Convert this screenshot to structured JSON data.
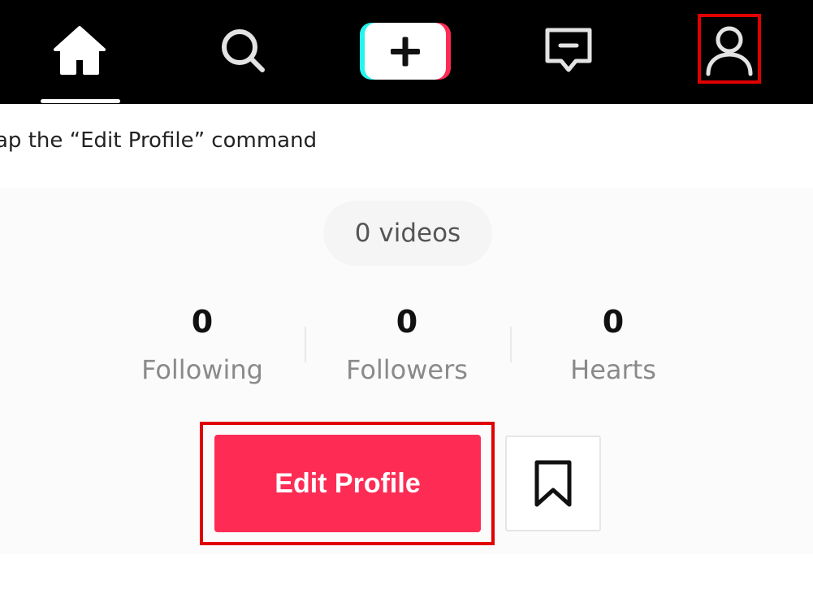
{
  "nav": {
    "items": [
      {
        "name": "home",
        "icon": "home-icon"
      },
      {
        "name": "discover",
        "icon": "search-icon"
      },
      {
        "name": "create",
        "icon": "plus-icon"
      },
      {
        "name": "inbox",
        "icon": "message-icon"
      },
      {
        "name": "profile",
        "icon": "user-icon"
      }
    ],
    "active": "home",
    "highlighted": "profile"
  },
  "instruction": {
    "text": "ap the “Edit Profile” command"
  },
  "profile": {
    "videos_label": "0 videos",
    "stats": [
      {
        "count": "0",
        "label": "Following"
      },
      {
        "count": "0",
        "label": "Followers"
      },
      {
        "count": "0",
        "label": "Hearts"
      }
    ],
    "edit_button_label": "Edit Profile",
    "bookmark_icon": "bookmark-icon"
  },
  "colors": {
    "nav_background": "#000000",
    "accent": "#fe2c55",
    "highlight": "#e00000",
    "tiktok_cyan": "#25f4ee"
  }
}
